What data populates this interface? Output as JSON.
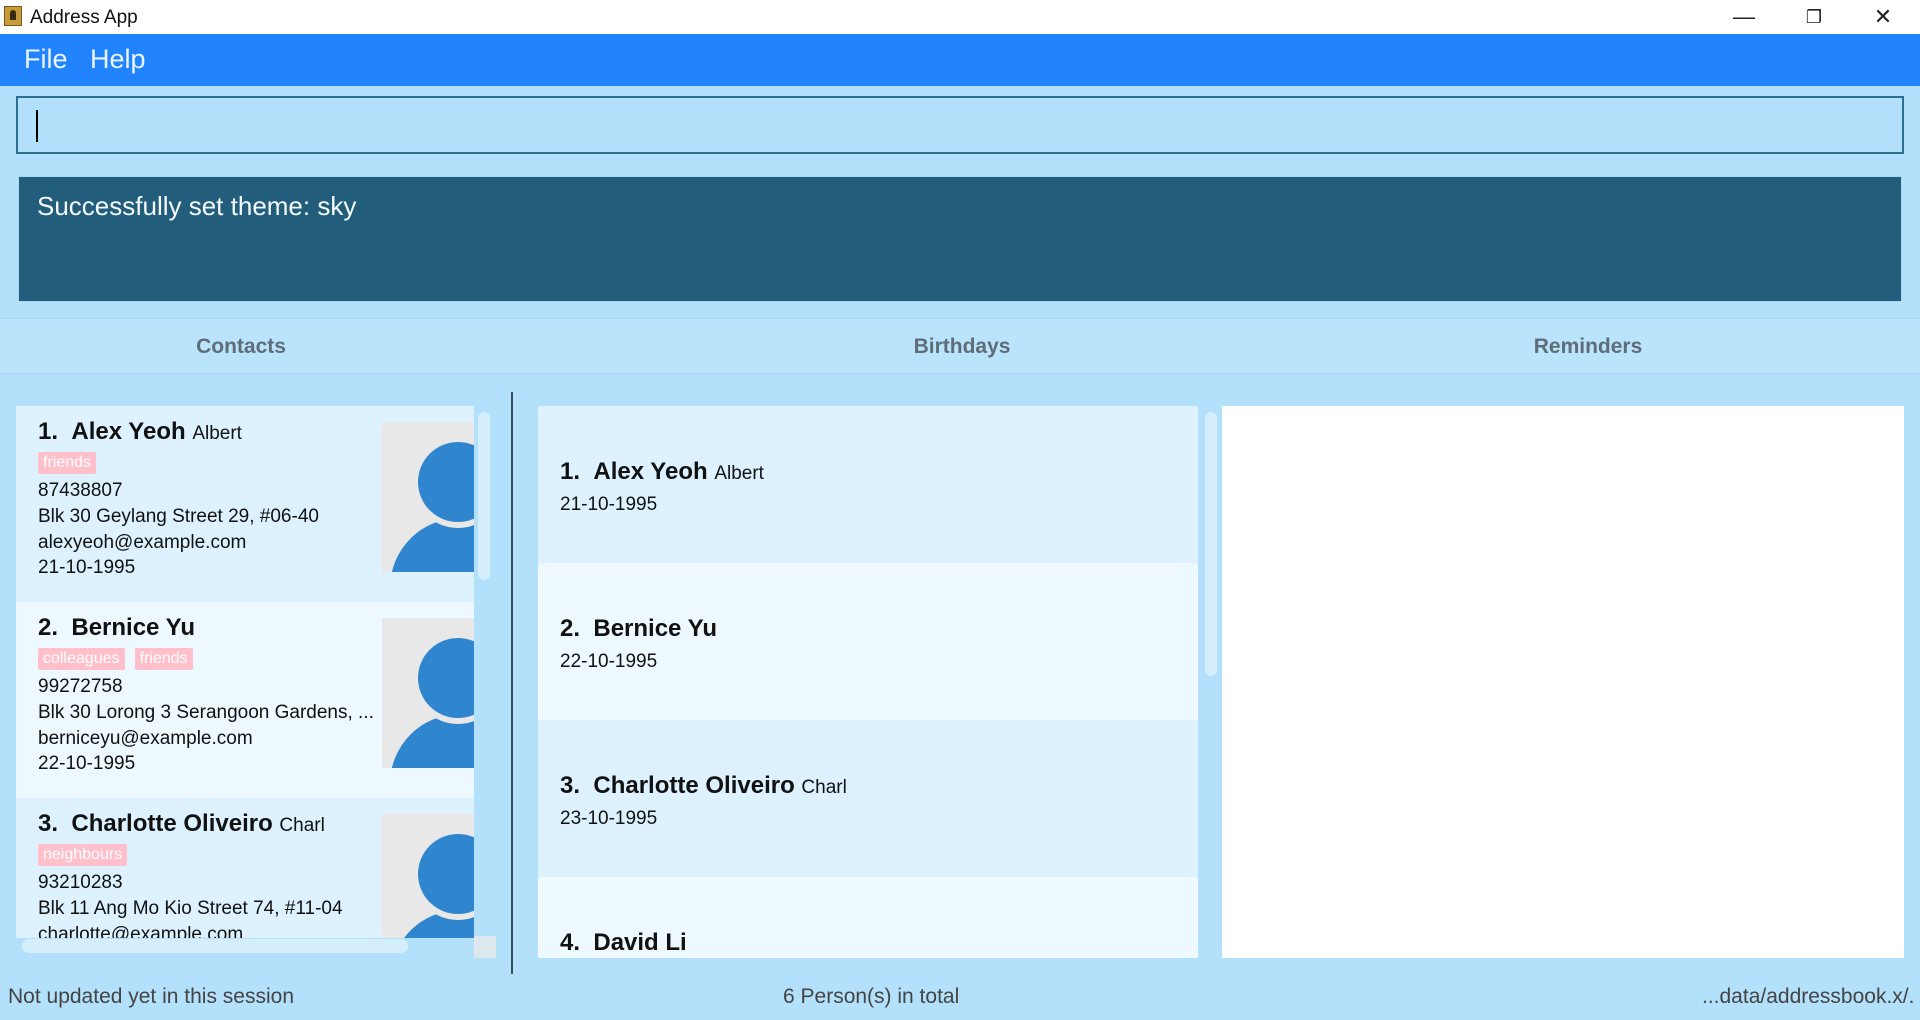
{
  "window": {
    "title": "Address App",
    "controls": {
      "minimize": "—",
      "maximize": "❐",
      "close": "✕"
    }
  },
  "menu": [
    {
      "label": "File"
    },
    {
      "label": "Help"
    }
  ],
  "command": {
    "value": "",
    "placeholder": ""
  },
  "result": {
    "text": "Successfully set theme: sky"
  },
  "panels": {
    "contacts": "Contacts",
    "birthdays": "Birthdays",
    "reminders": "Reminders"
  },
  "contacts": [
    {
      "index": "1.",
      "name": "Alex Yeoh",
      "nickname": "Albert",
      "tags": [
        "friends"
      ],
      "phone": "87438807",
      "address": "Blk 30 Geylang Street 29, #06-40",
      "email": "alexyeoh@example.com",
      "birthday": "21-10-1995"
    },
    {
      "index": "2.",
      "name": "Bernice Yu",
      "nickname": "",
      "tags": [
        "colleagues",
        "friends"
      ],
      "phone": "99272758",
      "address": "Blk 30 Lorong 3 Serangoon Gardens, ...",
      "email": "berniceyu@example.com",
      "birthday": "22-10-1995"
    },
    {
      "index": "3.",
      "name": "Charlotte Oliveiro",
      "nickname": "Charl",
      "tags": [
        "neighbours"
      ],
      "phone": "93210283",
      "address": "Blk 11 Ang Mo Kio Street 74, #11-04",
      "email": "charlotte@example.com",
      "birthday": ""
    }
  ],
  "birthdays": [
    {
      "index": "1.",
      "name": "Alex Yeoh",
      "nickname": "Albert",
      "date": "21-10-1995"
    },
    {
      "index": "2.",
      "name": "Bernice Yu",
      "nickname": "",
      "date": "22-10-1995"
    },
    {
      "index": "3.",
      "name": "Charlotte Oliveiro",
      "nickname": "Charl",
      "date": "23-10-1995"
    },
    {
      "index": "4.",
      "name": "David Li",
      "nickname": "",
      "date": ""
    }
  ],
  "status": {
    "left": "Not updated yet in this session",
    "center": "6 Person(s) in total",
    "right": "...data/addressbook.x/."
  },
  "colors": {
    "menubar": "#2284fd",
    "background": "#b3e0fb",
    "result_box": "#225d7c",
    "tag": "#ffc0cb",
    "avatar": "#2f86cf"
  }
}
